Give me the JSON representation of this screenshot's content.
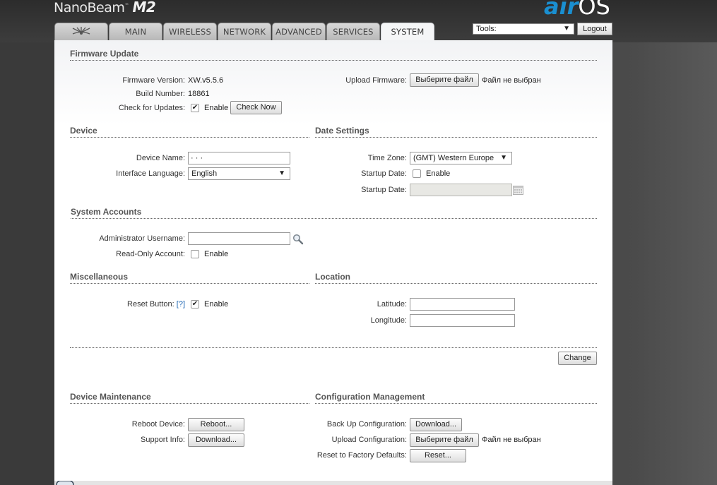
{
  "header": {
    "product": "NanoBeam",
    "model": "M2",
    "logo_air": "air",
    "logo_os": "OS"
  },
  "tabs": [
    {
      "label": "",
      "icon": "ubiquiti-logo-icon"
    },
    {
      "label": "MAIN"
    },
    {
      "label": "WIRELESS"
    },
    {
      "label": "NETWORK"
    },
    {
      "label": "ADVANCED"
    },
    {
      "label": "SERVICES"
    },
    {
      "label": "SYSTEM",
      "active": true
    }
  ],
  "tools": {
    "selected": "Tools:",
    "logout_label": "Logout"
  },
  "firmware": {
    "title": "Firmware Update",
    "version_label": "Firmware Version:",
    "version_value": "XW.v5.5.6",
    "build_label": "Build Number:",
    "build_value": "18861",
    "check_label": "Check for Updates:",
    "check_enable": "Enable",
    "check_now": "Check Now",
    "check_checked": true,
    "upload_label": "Upload Firmware:",
    "choose_file": "Выберите файл",
    "no_file": "Файл не выбран"
  },
  "device": {
    "title": "Device",
    "name_label": "Device Name:",
    "name_value": "· ·  ·",
    "lang_label": "Interface Language:",
    "lang_value": "English"
  },
  "date": {
    "title": "Date Settings",
    "tz_label": "Time Zone:",
    "tz_value": "(GMT) Western Europe",
    "startup_label": "Startup Date:",
    "startup_enable": "Enable",
    "startup_date_label": "Startup Date:",
    "startup_date_value": ""
  },
  "accounts": {
    "title": "System Accounts",
    "admin_label": "Administrator Username:",
    "admin_value": "",
    "readonly_label": "Read-Only Account:",
    "readonly_enable": "Enable"
  },
  "misc": {
    "title": "Miscellaneous",
    "reset_label": "Reset Button:",
    "reset_help": "[?]",
    "reset_enable": "Enable",
    "reset_checked": true
  },
  "location": {
    "title": "Location",
    "lat_label": "Latitude:",
    "lat_value": "",
    "lon_label": "Longitude:",
    "lon_value": ""
  },
  "change_label": "Change",
  "maintenance": {
    "title": "Device Maintenance",
    "reboot_label": "Reboot Device:",
    "reboot_btn": "Reboot...",
    "support_label": "Support Info:",
    "support_btn": "Download..."
  },
  "config": {
    "title": "Configuration Management",
    "backup_label": "Back Up Configuration:",
    "backup_btn": "Download...",
    "upload_label": "Upload Configuration:",
    "choose_file": "Выберите файл",
    "no_file": "Файл не выбран",
    "reset_label": "Reset to Factory Defaults:",
    "reset_btn": "Reset..."
  }
}
